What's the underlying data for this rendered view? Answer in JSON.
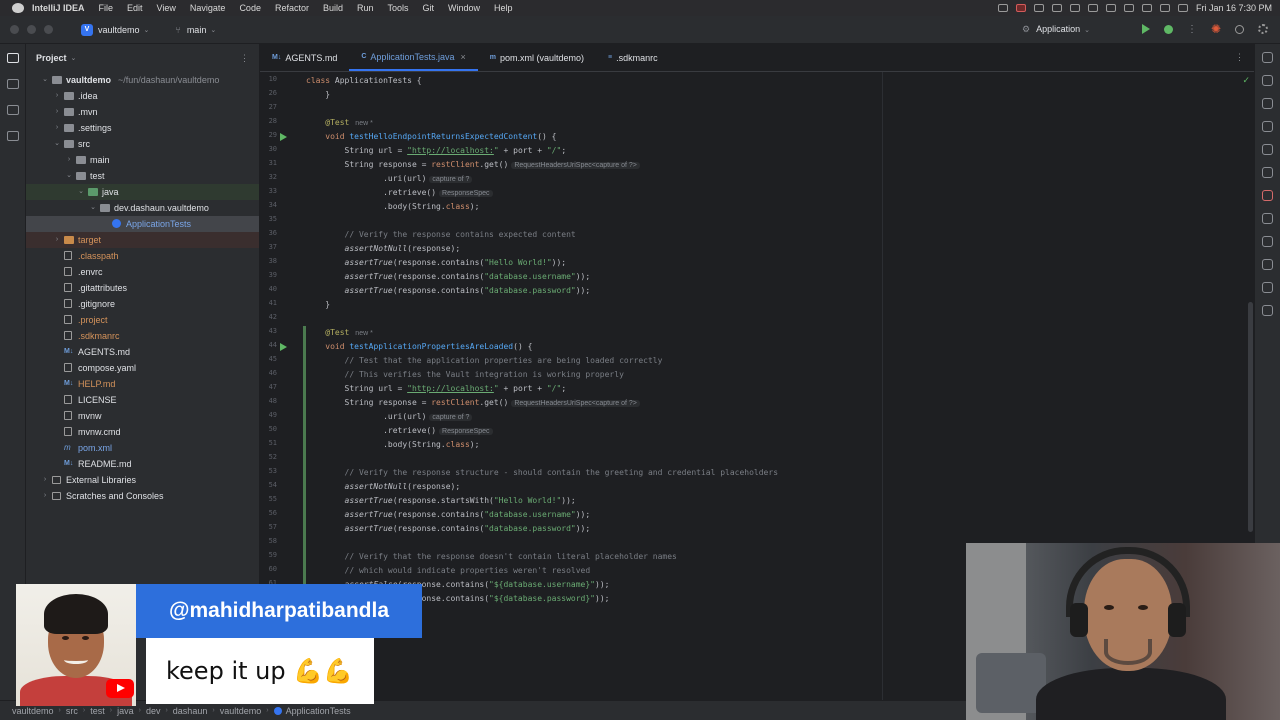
{
  "menubar": {
    "app": "IntelliJ IDEA",
    "items": [
      "File",
      "Edit",
      "View",
      "Navigate",
      "Code",
      "Refactor",
      "Build",
      "Run",
      "Tools",
      "Git",
      "Window",
      "Help"
    ],
    "clock": "Fri Jan 16  7:30 PM"
  },
  "toolbar": {
    "project_badge": "V",
    "project": "vaultdemo",
    "branch": "main",
    "run_config": "Application"
  },
  "project_panel": {
    "title": "Project",
    "tree": [
      {
        "label": "vaultdemo",
        "sub": "~/fun/dashaun/vaultdemo",
        "depth": 0,
        "expanded": true,
        "icon": "folder-icon",
        "style": "bold"
      },
      {
        "label": ".idea",
        "depth": 1,
        "expanded": false,
        "icon": "folder-icon"
      },
      {
        "label": ".mvn",
        "depth": 1,
        "expanded": false,
        "icon": "folder-icon"
      },
      {
        "label": ".settings",
        "depth": 1,
        "expanded": false,
        "icon": "folder-icon"
      },
      {
        "label": "src",
        "depth": 1,
        "expanded": true,
        "icon": "folder-icon"
      },
      {
        "label": "main",
        "depth": 2,
        "expanded": false,
        "icon": "folder-icon"
      },
      {
        "label": "test",
        "depth": 2,
        "expanded": true,
        "icon": "folder-icon"
      },
      {
        "label": "java",
        "depth": 3,
        "expanded": true,
        "icon": "folder-green-icon",
        "highlight": "green"
      },
      {
        "label": "dev.dashaun.vaultdemo",
        "depth": 4,
        "expanded": true,
        "icon": "package-icon"
      },
      {
        "label": "ApplicationTests",
        "depth": 5,
        "icon": "class-icon",
        "selected": true
      },
      {
        "label": "target",
        "depth": 1,
        "expanded": false,
        "icon": "folder-orange-icon",
        "highlight": "red",
        "color": "orange"
      },
      {
        "label": ".classpath",
        "depth": 1,
        "icon": "file-icon",
        "color": "orange"
      },
      {
        "label": ".envrc",
        "depth": 1,
        "icon": "file-icon"
      },
      {
        "label": ".gitattributes",
        "depth": 1,
        "icon": "file-icon"
      },
      {
        "label": ".gitignore",
        "depth": 1,
        "icon": "file-icon"
      },
      {
        "label": ".project",
        "depth": 1,
        "icon": "file-icon",
        "color": "orange"
      },
      {
        "label": ".sdkmanrc",
        "depth": 1,
        "icon": "file-icon",
        "color": "orange"
      },
      {
        "label": "AGENTS.md",
        "depth": 1,
        "icon": "markdown-icon"
      },
      {
        "label": "compose.yaml",
        "depth": 1,
        "icon": "file-icon"
      },
      {
        "label": "HELP.md",
        "depth": 1,
        "icon": "markdown-icon",
        "color": "orange"
      },
      {
        "label": "LICENSE",
        "depth": 1,
        "icon": "file-icon"
      },
      {
        "label": "mvnw",
        "depth": 1,
        "icon": "file-icon"
      },
      {
        "label": "mvnw.cmd",
        "depth": 1,
        "icon": "file-icon"
      },
      {
        "label": "pom.xml",
        "depth": 1,
        "icon": "maven-icon",
        "color": "blue"
      },
      {
        "label": "README.md",
        "depth": 1,
        "icon": "markdown-icon"
      },
      {
        "label": "External Libraries",
        "depth": 0,
        "expanded": false,
        "icon": "library-icon"
      },
      {
        "label": "Scratches and Consoles",
        "depth": 0,
        "expanded": false,
        "icon": "scratches-icon"
      }
    ]
  },
  "tabs": [
    {
      "icon": "M↓",
      "label": "AGENTS.md",
      "active": false
    },
    {
      "icon": "C",
      "label": "ApplicationTests.java",
      "active": true
    },
    {
      "icon": "m",
      "label": "pom.xml (vaultdemo)",
      "active": false
    },
    {
      "icon": "≡",
      "label": ".sdkmanrc",
      "active": false
    }
  ],
  "editor": {
    "lines": [
      {
        "n": "10",
        "tokens": [
          [
            "kw",
            "class "
          ],
          [
            "",
            "ApplicationTests {"
          ]
        ]
      },
      {
        "n": "26",
        "tokens": [
          [
            "",
            "    }"
          ]
        ]
      },
      {
        "n": "27",
        "tokens": []
      },
      {
        "n": "28",
        "tokens": [
          [
            "an",
            "    @Test"
          ],
          [
            "new",
            " new *"
          ]
        ]
      },
      {
        "n": "29",
        "tokens": [
          [
            "kw",
            "    void "
          ],
          [
            "fn",
            "testHelloEndpointReturnsExpectedContent"
          ],
          [
            "",
            "() {"
          ]
        ],
        "run": true
      },
      {
        "n": "30",
        "tokens": [
          [
            "",
            "        String url = "
          ],
          [
            "url",
            "\"http://localhost:"
          ],
          [
            "st",
            "\""
          ],
          [
            "",
            " + port + "
          ],
          [
            "st",
            "\"/\""
          ],
          [
            "",
            ";"
          ]
        ]
      },
      {
        "n": "31",
        "tokens": [
          [
            "",
            "        String response = "
          ],
          [
            "kw",
            "restClient"
          ],
          [
            "",
            ".get()"
          ],
          [
            "hint",
            "RequestHeadersUriSpec<capture of ?>"
          ]
        ]
      },
      {
        "n": "32",
        "tokens": [
          [
            "",
            "                .uri(url)"
          ],
          [
            "hint",
            "capture of ?"
          ]
        ]
      },
      {
        "n": "33",
        "tokens": [
          [
            "",
            "                .retrieve()"
          ],
          [
            "hint",
            "ResponseSpec"
          ]
        ]
      },
      {
        "n": "34",
        "tokens": [
          [
            "",
            "                .body(String."
          ],
          [
            "kw",
            "class"
          ],
          [
            "",
            ");"
          ]
        ]
      },
      {
        "n": "35",
        "tokens": []
      },
      {
        "n": "36",
        "tokens": [
          [
            "cm",
            "        // Verify the response contains expected content"
          ]
        ]
      },
      {
        "n": "37",
        "tokens": [
          [
            "it",
            "        assertNotNull"
          ],
          [
            "",
            "(response);"
          ]
        ]
      },
      {
        "n": "38",
        "tokens": [
          [
            "it",
            "        assertTrue"
          ],
          [
            "",
            "(response.contains("
          ],
          [
            "st",
            "\"Hello World!\""
          ],
          [
            "",
            "));"
          ]
        ]
      },
      {
        "n": "39",
        "tokens": [
          [
            "it",
            "        assertTrue"
          ],
          [
            "",
            "(response.contains("
          ],
          [
            "st",
            "\"database.username\""
          ],
          [
            "",
            "));"
          ]
        ]
      },
      {
        "n": "40",
        "tokens": [
          [
            "it",
            "        assertTrue"
          ],
          [
            "",
            "(response.contains("
          ],
          [
            "st",
            "\"database.password\""
          ],
          [
            "",
            "));"
          ]
        ]
      },
      {
        "n": "41",
        "tokens": [
          [
            "",
            "    }"
          ]
        ]
      },
      {
        "n": "42",
        "tokens": []
      },
      {
        "n": "43",
        "tokens": [
          [
            "an",
            "    @Test"
          ],
          [
            "new",
            " new *"
          ]
        ]
      },
      {
        "n": "44",
        "tokens": [
          [
            "kw",
            "    void "
          ],
          [
            "fn",
            "testApplicationPropertiesAreLoaded"
          ],
          [
            "",
            "() {"
          ]
        ],
        "run": true
      },
      {
        "n": "45",
        "tokens": [
          [
            "cm",
            "        // Test that the application properties are being loaded correctly"
          ]
        ]
      },
      {
        "n": "46",
        "tokens": [
          [
            "cm",
            "        // This verifies the Vault integration is working properly"
          ]
        ]
      },
      {
        "n": "47",
        "tokens": [
          [
            "",
            "        String url = "
          ],
          [
            "url",
            "\"http://localhost:"
          ],
          [
            "st",
            "\""
          ],
          [
            "",
            " + port + "
          ],
          [
            "st",
            "\"/\""
          ],
          [
            "",
            ";"
          ]
        ]
      },
      {
        "n": "48",
        "tokens": [
          [
            "",
            "        String response = "
          ],
          [
            "kw",
            "restClient"
          ],
          [
            "",
            ".get()"
          ],
          [
            "hint",
            "RequestHeadersUriSpec<capture of ?>"
          ]
        ]
      },
      {
        "n": "49",
        "tokens": [
          [
            "",
            "                .uri(url)"
          ],
          [
            "hint",
            "capture of ?"
          ]
        ]
      },
      {
        "n": "50",
        "tokens": [
          [
            "",
            "                .retrieve()"
          ],
          [
            "hint",
            "ResponseSpec"
          ]
        ]
      },
      {
        "n": "51",
        "tokens": [
          [
            "",
            "                .body(String."
          ],
          [
            "kw",
            "class"
          ],
          [
            "",
            ");"
          ]
        ]
      },
      {
        "n": "52",
        "tokens": []
      },
      {
        "n": "53",
        "tokens": [
          [
            "cm",
            "        // Verify the response structure - should contain the greeting and credential placeholders"
          ]
        ]
      },
      {
        "n": "54",
        "tokens": [
          [
            "it",
            "        assertNotNull"
          ],
          [
            "",
            "(response);"
          ]
        ]
      },
      {
        "n": "55",
        "tokens": [
          [
            "it",
            "        assertTrue"
          ],
          [
            "",
            "(response.startsWith("
          ],
          [
            "st",
            "\"Hello World!\""
          ],
          [
            "",
            "));"
          ]
        ]
      },
      {
        "n": "56",
        "tokens": [
          [
            "it",
            "        assertTrue"
          ],
          [
            "",
            "(response.contains("
          ],
          [
            "st",
            "\"database.username\""
          ],
          [
            "",
            "));"
          ]
        ]
      },
      {
        "n": "57",
        "tokens": [
          [
            "it",
            "        assertTrue"
          ],
          [
            "",
            "(response.contains("
          ],
          [
            "st",
            "\"database.password\""
          ],
          [
            "",
            "));"
          ]
        ]
      },
      {
        "n": "58",
        "tokens": []
      },
      {
        "n": "59",
        "tokens": [
          [
            "cm",
            "        // Verify that the response doesn't contain literal placeholder names"
          ]
        ]
      },
      {
        "n": "60",
        "tokens": [
          [
            "cm",
            "        // which would indicate properties weren't resolved"
          ]
        ]
      },
      {
        "n": "61",
        "tokens": [
          [
            "it",
            "        assertFalse"
          ],
          [
            "",
            "(response.contains("
          ],
          [
            "st",
            "\"${database.username}\""
          ],
          [
            "",
            "));"
          ]
        ]
      },
      {
        "n": "62",
        "tokens": [
          [
            "it",
            "        assertFalse"
          ],
          [
            "",
            "(response.contains("
          ],
          [
            "st",
            "\"${database.password}\""
          ],
          [
            "",
            "));"
          ]
        ]
      }
    ]
  },
  "statusbar": {
    "crumbs": [
      "vaultdemo",
      "src",
      "test",
      "java",
      "dev",
      "dashaun",
      "vaultdemo",
      "ApplicationTests"
    ]
  },
  "overlay": {
    "handle": "@mahidharpatibandla",
    "comment": "keep it up 💪💪"
  },
  "colors": {
    "accent": "#3574f0",
    "banner": "#2d6fdc",
    "youtube": "#ff0000"
  }
}
